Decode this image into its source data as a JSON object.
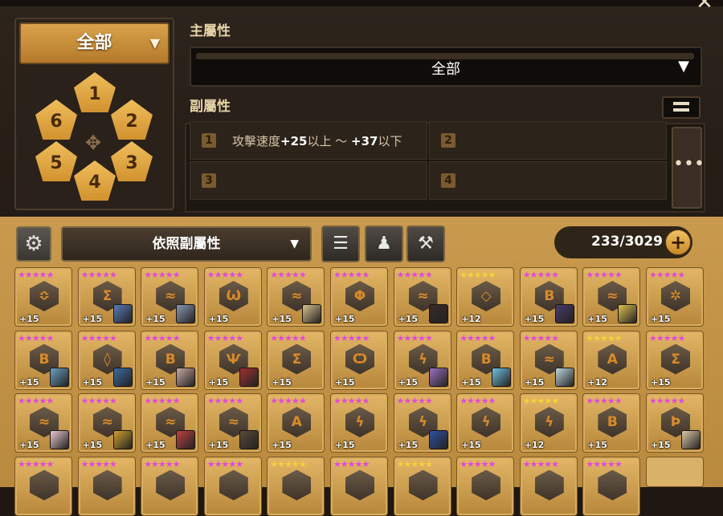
{
  "close_label": "✕",
  "set_filter": {
    "selected": "全部",
    "slots": [
      "1",
      "2",
      "3",
      "4",
      "5",
      "6"
    ],
    "compass_icon": "compass-icon"
  },
  "main_stat": {
    "label": "主屬性",
    "selected": "全部"
  },
  "sub_stat": {
    "label": "副屬性",
    "slots": [
      {
        "num": "1",
        "text": "攻擊速度",
        "from": "+25",
        "mid": "以上 ～ ",
        "to": "+37",
        "tail": "以下"
      },
      {
        "num": "2"
      },
      {
        "num": "3"
      },
      {
        "num": "4"
      }
    ],
    "more_label": "•••"
  },
  "toolbar": {
    "sort_label": "依照副屬性",
    "sort_icon": "sort-order-icon",
    "bag_icon": "powder-bag-icon",
    "hammer_icon": "hammer-icon",
    "count": "233/3029",
    "plus_label": "+"
  },
  "colors": {
    "pink_star": "#e04ad8",
    "gold_star": "#f2d23a",
    "rune_glyph": "#d98b2a"
  },
  "runes": [
    {
      "stars": "pink",
      "glyph": "≎",
      "level": "+15",
      "portrait": null
    },
    {
      "stars": "pink",
      "glyph": "Σ",
      "level": "+15",
      "portrait": "#5a7ab8"
    },
    {
      "stars": "pink",
      "glyph": "≈",
      "level": "+15",
      "portrait": "#8a9ab0"
    },
    {
      "stars": "pink",
      "glyph": "Ѡ",
      "level": "+15",
      "portrait": null
    },
    {
      "stars": "pink",
      "glyph": "≈",
      "level": "+15",
      "portrait": "#d8c090"
    },
    {
      "stars": "pink",
      "glyph": "Φ",
      "level": "+15",
      "portrait": null
    },
    {
      "stars": "pink",
      "glyph": "≈",
      "level": "+15",
      "portrait": "#3a2a2a"
    },
    {
      "stars": "gold",
      "glyph": "◇",
      "level": "+12",
      "portrait": null
    },
    {
      "stars": "pink",
      "glyph": "B",
      "level": "+15",
      "portrait": "#4a3a6a"
    },
    {
      "stars": "pink",
      "glyph": "≈",
      "level": "+15",
      "portrait": "#e0c050"
    },
    {
      "stars": "pink",
      "glyph": "✲",
      "level": "+15",
      "portrait": null
    },
    {
      "stars": "pink",
      "glyph": "B",
      "level": "+15",
      "portrait": "#6aa0c0"
    },
    {
      "stars": "pink",
      "glyph": "◊",
      "level": "+15",
      "portrait": "#3a6aa0"
    },
    {
      "stars": "pink",
      "glyph": "B",
      "level": "+15",
      "portrait": "#c8a8a0"
    },
    {
      "stars": "pink",
      "glyph": "Ѱ",
      "level": "+15",
      "portrait": "#a03030"
    },
    {
      "stars": "pink",
      "glyph": "Σ",
      "level": "+15",
      "portrait": null
    },
    {
      "stars": "pink",
      "glyph": "Ѻ",
      "level": "+15",
      "portrait": null
    },
    {
      "stars": "pink",
      "glyph": "ϟ",
      "level": "+15",
      "portrait": "#9a70c0"
    },
    {
      "stars": "pink",
      "glyph": "B",
      "level": "+15",
      "portrait": "#70c0e0"
    },
    {
      "stars": "pink",
      "glyph": "≈",
      "level": "+15",
      "portrait": "#c0d8e0"
    },
    {
      "stars": "gold",
      "glyph": "A",
      "level": "+12",
      "portrait": null
    },
    {
      "stars": "pink",
      "glyph": "Σ",
      "level": "+15",
      "portrait": null
    },
    {
      "stars": "pink",
      "glyph": "≈",
      "level": "+15",
      "portrait": "#e8c8d0"
    },
    {
      "stars": "pink",
      "glyph": "≈",
      "level": "+15",
      "portrait": "#d0a030"
    },
    {
      "stars": "pink",
      "glyph": "≈",
      "level": "+15",
      "portrait": "#c04040"
    },
    {
      "stars": "pink",
      "glyph": "≈",
      "level": "+15",
      "portrait": "#5a4a3a"
    },
    {
      "stars": "pink",
      "glyph": "A",
      "level": "+15",
      "portrait": null
    },
    {
      "stars": "pink",
      "glyph": "ϟ",
      "level": "+15",
      "portrait": null
    },
    {
      "stars": "pink",
      "glyph": "ϟ",
      "level": "+15",
      "portrait": "#3050a0"
    },
    {
      "stars": "pink",
      "glyph": "ϟ",
      "level": "+15",
      "portrait": null
    },
    {
      "stars": "gold",
      "glyph": "ϟ",
      "level": "+12",
      "portrait": null
    },
    {
      "stars": "pink",
      "glyph": "B",
      "level": "+15",
      "portrait": null
    },
    {
      "stars": "pink",
      "glyph": "Ϸ",
      "level": "+15",
      "portrait": "#e0c8a8"
    },
    {
      "stars": "pink",
      "glyph": "",
      "level": "",
      "portrait": null
    },
    {
      "stars": "pink",
      "glyph": "",
      "level": "",
      "portrait": null
    },
    {
      "stars": "pink",
      "glyph": "",
      "level": "",
      "portrait": null
    },
    {
      "stars": "pink",
      "glyph": "",
      "level": "",
      "portrait": null
    },
    {
      "stars": "gold",
      "glyph": "",
      "level": "",
      "portrait": null
    },
    {
      "stars": "pink",
      "glyph": "",
      "level": "",
      "portrait": null
    },
    {
      "stars": "gold",
      "glyph": "",
      "level": "",
      "portrait": null
    },
    {
      "stars": "pink",
      "glyph": "",
      "level": "",
      "portrait": null
    },
    {
      "stars": "pink",
      "glyph": "",
      "level": "",
      "portrait": null
    },
    {
      "stars": "pink",
      "glyph": "",
      "level": "",
      "portrait": null
    }
  ],
  "star_glyphs": "★★★★★"
}
